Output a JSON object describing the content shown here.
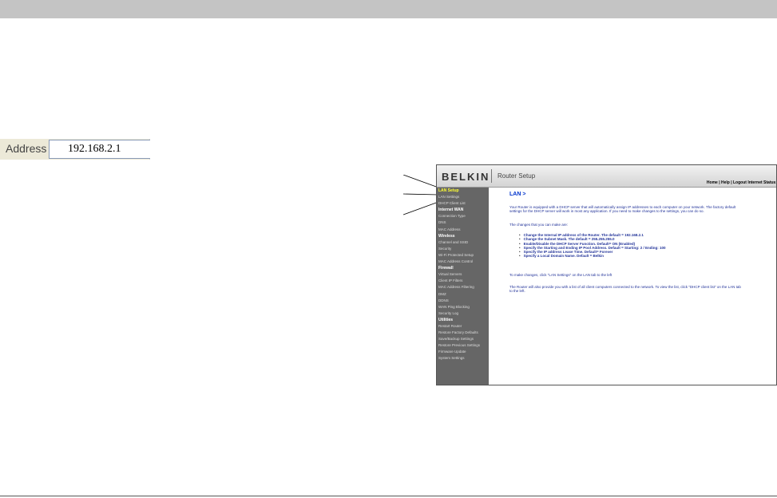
{
  "address_bar": {
    "label": "Address",
    "value": "192.168.2.1"
  },
  "router_ui": {
    "brand": "BELKIN",
    "app_title": "Router Setup",
    "top_links": "Home | Help | Logout   Internet Status:",
    "sidebar": [
      {
        "label": "LAN Setup",
        "type": "head-active"
      },
      {
        "label": "LAN Settings",
        "type": "item"
      },
      {
        "label": "DHCP Client List",
        "type": "item"
      },
      {
        "label": "Internet WAN",
        "type": "head"
      },
      {
        "label": "Connection Type",
        "type": "item"
      },
      {
        "label": "DNS",
        "type": "item"
      },
      {
        "label": "MAC Address",
        "type": "item"
      },
      {
        "label": "Wireless",
        "type": "head"
      },
      {
        "label": "Channel and SSID",
        "type": "item"
      },
      {
        "label": "Security",
        "type": "item"
      },
      {
        "label": "Wi-Fi Protected Setup",
        "type": "item"
      },
      {
        "label": "MAC Address Control",
        "type": "item"
      },
      {
        "label": "Firewall",
        "type": "head"
      },
      {
        "label": "Virtual Servers",
        "type": "item"
      },
      {
        "label": "Client IP Filters",
        "type": "item"
      },
      {
        "label": "MAC Address Filtering",
        "type": "item"
      },
      {
        "label": "DMZ",
        "type": "item"
      },
      {
        "label": "DDNS",
        "type": "item"
      },
      {
        "label": "WAN Ping Blocking",
        "type": "item"
      },
      {
        "label": "Security Log",
        "type": "item"
      },
      {
        "label": "Utilities",
        "type": "head"
      },
      {
        "label": "Restart Router",
        "type": "item"
      },
      {
        "label": "Restore Factory Defaults",
        "type": "item"
      },
      {
        "label": "Save/Backup Settings",
        "type": "item"
      },
      {
        "label": "Restore Previous Settings",
        "type": "item"
      },
      {
        "label": "Firmware Update",
        "type": "item"
      },
      {
        "label": "System Settings",
        "type": "item"
      }
    ],
    "content": {
      "title": "LAN >",
      "intro": "Your Router is equipped with a DHCP server that will automatically assign IP addresses to each computer on your network. The factory default settings for the DHCP server will work in most any application. If you need to make changes to the settings, you can do so.",
      "changes_heading": "The changes that you can make are:",
      "bullets": [
        "Change the Internal IP address of the Router. The default = 192.168.2.1",
        "Change the Subnet Mask. The default = 255.255.255.0",
        "Enable/Disable the DHCP Server Function. Default= ON (Enabled)",
        "Specify the Starting and Ending IP Pool Address. Default = Starting: 2 / Ending: 100",
        "Specify the IP address Lease Time. Default= Forever",
        "Specify a Local Domain Name. Default = Belkin"
      ],
      "make_changes": "To make changes, click \"LAN Settings\" on the LAN tab to the left",
      "client_list": "The Router will also provide you with a list of all client computers connected to the network. To view the list, click \"DHCP client list\" on the LAN tab to the left."
    }
  }
}
